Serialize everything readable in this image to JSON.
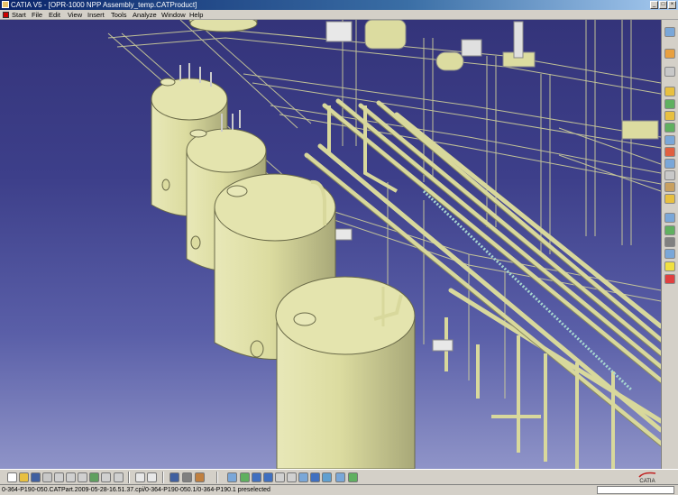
{
  "window": {
    "title": "CATIA V5 - [OPR-1000 NPP Assembly_temp.CATProduct]",
    "controls": [
      "minimize",
      "maximize",
      "close"
    ]
  },
  "menu": {
    "items": [
      "Start",
      "File",
      "Edit",
      "View",
      "Insert",
      "Tools",
      "Analyze",
      "Window",
      "Help"
    ]
  },
  "status": {
    "text": "0-364-P190-050.CATPart.2009-05-28-16.51.37.cpi/0-364-P190-050.1/0-364-P190.1 preselected",
    "command_value": ""
  },
  "logo": {
    "text": "CATIA"
  },
  "colors": {
    "tank_fill": "#dcdca0",
    "pipe": "#d8d89c",
    "background_top": "#34347a",
    "background_bottom": "#8f94c8",
    "title_bar": "#0a246a"
  },
  "right_toolbar": {
    "icons": [
      "sketcher-icon",
      "part-design-icon",
      "assembly-icon",
      "constraint-icon",
      "product-icon",
      "fix-icon",
      "snap-icon",
      "explode-icon",
      "clash-icon",
      "section-icon",
      "distance-icon",
      "measure-icon",
      "catalog-icon",
      "bill-of-material-icon",
      "scene-icon",
      "annotation-icon",
      "render-icon",
      "light-icon",
      "delete-icon"
    ]
  },
  "bottom_toolbar": {
    "icons": [
      "new-icon",
      "open-icon",
      "save-icon",
      "print-icon",
      "cut-icon",
      "copy-icon",
      "paste-icon",
      "undo-icon",
      "redo-icon",
      "whats-this-icon",
      "formula-icon",
      "comment-icon",
      "catalog-browser-icon",
      "measure-tool-icon",
      "apply-material-icon",
      "fly-mode-icon",
      "fit-all-icon",
      "pan-icon",
      "rotate-icon",
      "zoom-in-icon",
      "zoom-out-icon",
      "normal-view-icon",
      "quick-view-icon",
      "render-style-icon",
      "hide-show-icon",
      "swap-visible-icon"
    ]
  }
}
